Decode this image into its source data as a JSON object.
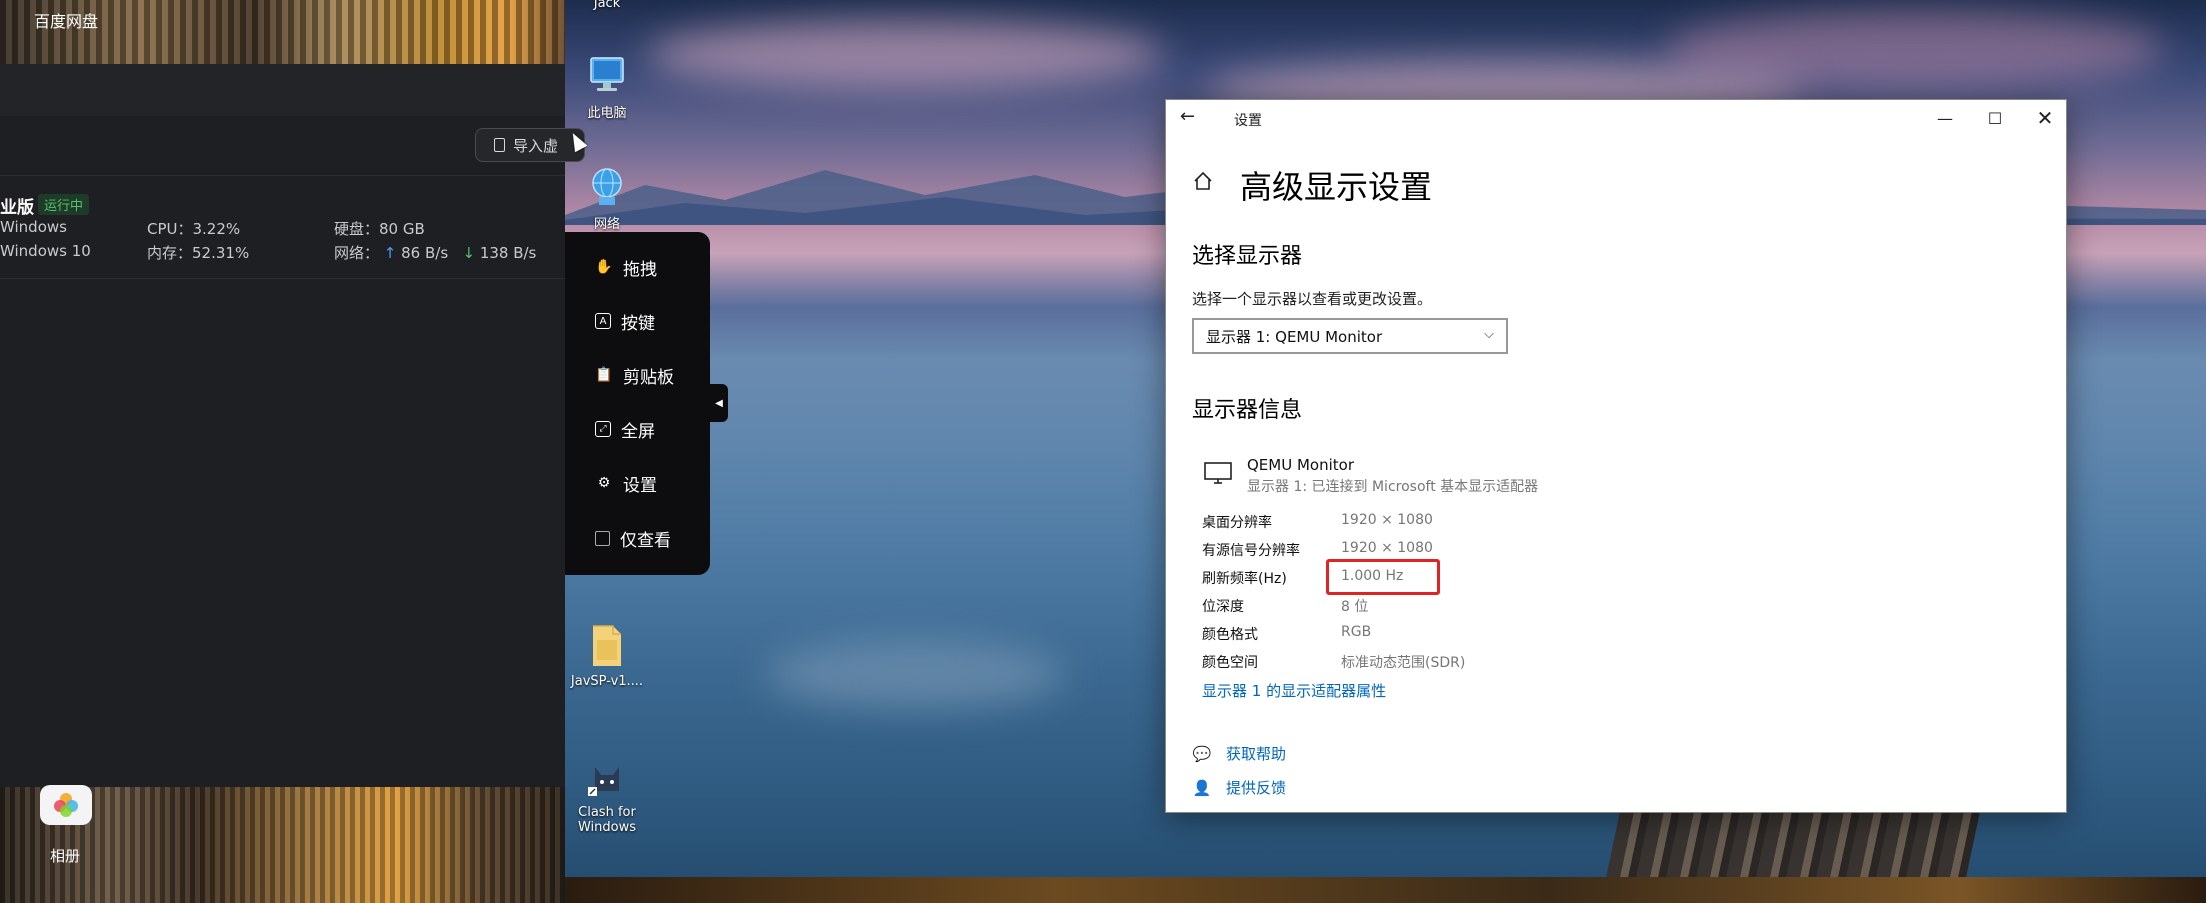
{
  "left_app": {
    "title": "百度网盘",
    "import_label": "导入虚",
    "vm": {
      "name": "业版",
      "status": "运行中",
      "os_family": "Windows",
      "os_version": "Windows 10",
      "cpu": "CPU：3.22%",
      "memory": "内存：52.31%",
      "disk": "硬盘：80 GB",
      "network_label": "网络：",
      "upload": "86 B/s",
      "download": "138 B/s"
    },
    "album_label": "相册"
  },
  "desktop": {
    "user_label": "Jack",
    "icons": [
      {
        "label": "此电脑"
      },
      {
        "label": "网络"
      },
      {
        "label": "JavSP-v1...."
      },
      {
        "label": "Clash for\nWindows"
      }
    ]
  },
  "float_menu": {
    "items": [
      {
        "label": "拖拽",
        "icon": "hand-icon"
      },
      {
        "label": "按键",
        "icon": "keyboard-key-icon"
      },
      {
        "label": "剪贴板",
        "icon": "clipboard-icon"
      },
      {
        "label": "全屏",
        "icon": "fullscreen-icon"
      },
      {
        "label": "设置",
        "icon": "gear-icon"
      },
      {
        "label": "仅查看",
        "icon": "checkbox-icon"
      }
    ]
  },
  "settings": {
    "window_title": "设置",
    "page_title": "高级显示设置",
    "select_section": "选择显示器",
    "select_desc": "选择一个显示器以查看或更改设置。",
    "selected_display": "显示器 1: QEMU Monitor",
    "info_section": "显示器信息",
    "monitor_name": "QEMU Monitor",
    "monitor_sub": "显示器 1: 已连接到 Microsoft 基本显示适配器",
    "info_rows": [
      {
        "label": "桌面分辨率",
        "value": "1920 × 1080"
      },
      {
        "label": "有源信号分辨率",
        "value": "1920 × 1080"
      },
      {
        "label": "刷新频率(Hz)",
        "value": "1.000 Hz"
      },
      {
        "label": "位深度",
        "value": "8 位"
      },
      {
        "label": "颜色格式",
        "value": "RGB"
      },
      {
        "label": "颜色空间",
        "value": "标准动态范围(SDR)"
      }
    ],
    "adapter_link": "显示器 1 的显示适配器属性",
    "help_link": "获取帮助",
    "feedback_link": "提供反馈"
  },
  "colors": {
    "link": "#0067c0",
    "highlight": "#e02424",
    "running_green": "#57c26a"
  }
}
